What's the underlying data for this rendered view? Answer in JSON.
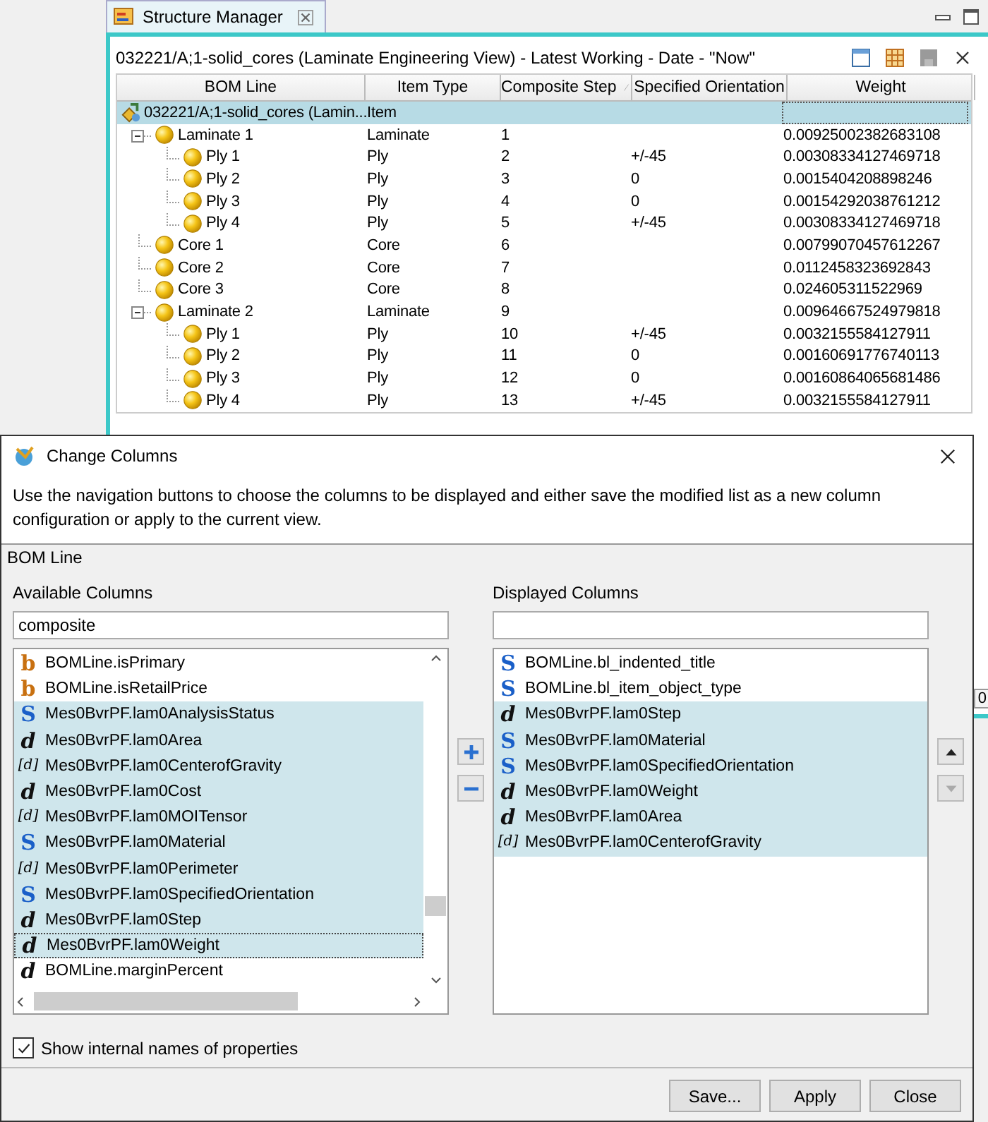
{
  "structure_manager": {
    "tab_title": "Structure Manager",
    "context": "032221/A;1-solid_cores (Laminate Engineering View) - Latest Working - Date - \"Now\"",
    "columns": [
      {
        "label": "BOM Line",
        "sorted": false
      },
      {
        "label": "Item Type",
        "sorted": false
      },
      {
        "label": "Composite Step",
        "sorted": true
      },
      {
        "label": "Specified Orientation",
        "sorted": false
      },
      {
        "label": "Weight",
        "sorted": false
      }
    ],
    "rows": [
      {
        "kind": "assembly",
        "name": "032221/A;1-solid_cores (Lamin...",
        "item_type": "Item",
        "selected": true,
        "children": [
          {
            "kind": "part",
            "name": "Laminate 1",
            "item_type": "Laminate",
            "step": "1",
            "weight": "0.00925002382683108",
            "selected": false,
            "expanded": true,
            "children": [
              {
                "kind": "part",
                "name": "Ply 1",
                "item_type": "Ply",
                "step": "2",
                "orientation": "+/-45",
                "weight": "0.00308334127469718",
                "selected": false
              },
              {
                "kind": "part",
                "name": "Ply 2",
                "item_type": "Ply",
                "step": "3",
                "orientation": "0",
                "weight": "0.0015404208898246",
                "selected": false
              },
              {
                "kind": "part",
                "name": "Ply 3",
                "item_type": "Ply",
                "step": "4",
                "orientation": "0",
                "weight": "0.00154292038761212",
                "selected": false
              },
              {
                "kind": "part",
                "name": "Ply 4",
                "item_type": "Ply",
                "step": "5",
                "orientation": "+/-45",
                "weight": "0.00308334127469718",
                "selected": false
              }
            ]
          },
          {
            "kind": "part",
            "name": "Core 1",
            "item_type": "Core",
            "step": "6",
            "weight": "0.00799070457612267",
            "selected": false
          },
          {
            "kind": "part",
            "name": "Core 2",
            "item_type": "Core",
            "step": "7",
            "weight": "0.0112458323692843",
            "selected": false
          },
          {
            "kind": "part",
            "name": "Core 3",
            "item_type": "Core",
            "step": "8",
            "weight": "0.024605311522969",
            "selected": false
          },
          {
            "kind": "part",
            "name": "Laminate 2",
            "item_type": "Laminate",
            "step": "9",
            "weight": "0.00964667524979818",
            "selected": false,
            "expanded": true,
            "children": [
              {
                "kind": "part",
                "name": "Ply 1",
                "item_type": "Ply",
                "step": "10",
                "orientation": "+/-45",
                "weight": "0.0032155584127911",
                "selected": false
              },
              {
                "kind": "part",
                "name": "Ply 2",
                "item_type": "Ply",
                "step": "11",
                "orientation": "0",
                "weight": "0.00160691776740113",
                "selected": false
              },
              {
                "kind": "part",
                "name": "Ply 3",
                "item_type": "Ply",
                "step": "12",
                "orientation": "0",
                "weight": "0.00160864065681486",
                "selected": false
              },
              {
                "kind": "part",
                "name": "Ply 4",
                "item_type": "Ply",
                "step": "13",
                "orientation": "+/-45",
                "weight": "0.0032155584127911",
                "selected": false
              }
            ]
          }
        ]
      }
    ],
    "status_text": "0"
  },
  "dialog": {
    "title": "Change Columns",
    "description": "Use the navigation buttons to choose the columns to be displayed and either save the modified list as a new column configuration or apply to the current view.",
    "section": "BOM Line",
    "available": {
      "label": "Available Columns",
      "filter": "composite",
      "items": [
        {
          "type": "b",
          "name": "BOMLine.isPrimary",
          "selected": false,
          "focused": false
        },
        {
          "type": "b",
          "name": "BOMLine.isRetailPrice",
          "selected": false,
          "focused": false
        },
        {
          "type": "S",
          "name": "Mes0BvrPF.lam0AnalysisStatus",
          "selected": true,
          "focused": false
        },
        {
          "type": "d",
          "name": "Mes0BvrPF.lam0Area",
          "selected": true,
          "focused": false
        },
        {
          "type": "[d]",
          "name": "Mes0BvrPF.lam0CenterofGravity",
          "selected": true,
          "focused": false
        },
        {
          "type": "d",
          "name": "Mes0BvrPF.lam0Cost",
          "selected": true,
          "focused": false
        },
        {
          "type": "[d]",
          "name": "Mes0BvrPF.lam0MOITensor",
          "selected": true,
          "focused": false
        },
        {
          "type": "S",
          "name": "Mes0BvrPF.lam0Material",
          "selected": true,
          "focused": false
        },
        {
          "type": "[d]",
          "name": "Mes0BvrPF.lam0Perimeter",
          "selected": true,
          "focused": false
        },
        {
          "type": "S",
          "name": "Mes0BvrPF.lam0SpecifiedOrientation",
          "selected": true,
          "focused": false
        },
        {
          "type": "d",
          "name": "Mes0BvrPF.lam0Step",
          "selected": true,
          "focused": false
        },
        {
          "type": "d",
          "name": "Mes0BvrPF.lam0Weight",
          "selected": true,
          "focused": true
        },
        {
          "type": "d",
          "name": "BOMLine.marginPercent",
          "selected": false,
          "focused": false
        }
      ]
    },
    "displayed": {
      "label": "Displayed Columns",
      "items": [
        {
          "type": "S",
          "name": "BOMLine.bl_indented_title",
          "selected": false
        },
        {
          "type": "S",
          "name": "BOMLine.bl_item_object_type",
          "selected": false
        },
        {
          "type": "d",
          "name": "Mes0BvrPF.lam0Step",
          "selected": true
        },
        {
          "type": "S",
          "name": "Mes0BvrPF.lam0Material",
          "selected": true
        },
        {
          "type": "S",
          "name": "Mes0BvrPF.lam0SpecifiedOrientation",
          "selected": true
        },
        {
          "type": "d",
          "name": "Mes0BvrPF.lam0Weight",
          "selected": true
        },
        {
          "type": "d",
          "name": "Mes0BvrPF.lam0Area",
          "selected": true
        },
        {
          "type": "[d]",
          "name": "Mes0BvrPF.lam0CenterofGravity",
          "selected": true
        }
      ]
    },
    "order_buttons": [
      {
        "kind": "up",
        "disabled": false
      },
      {
        "kind": "down",
        "disabled": true
      }
    ],
    "show_internal": {
      "label": "Show internal names of properties",
      "checked": true
    },
    "buttons": [
      "Save...",
      "Apply",
      "Close"
    ]
  }
}
